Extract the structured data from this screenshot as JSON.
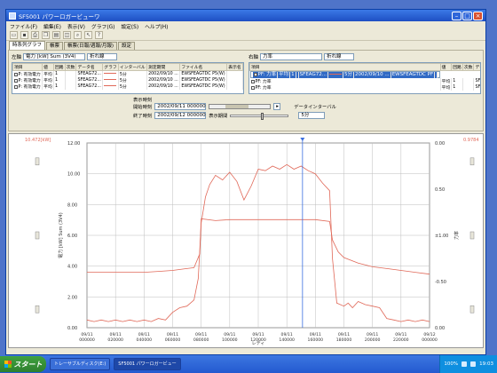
{
  "app": {
    "title": "SF5001 パワーロガービューワ"
  },
  "menu": [
    "ファイル(F)",
    "編集(E)",
    "表示(V)",
    "グラフ(G)",
    "設定(S)",
    "ヘルプ(H)"
  ],
  "tabs": [
    "時系列グラフ",
    "帳票",
    "帳票(日報/週報/月報)",
    "設定"
  ],
  "left_panel": {
    "axis_label": "左軸",
    "axis_value": "電力 [kW] Sum (3V4)",
    "chart_type": "折れ線",
    "columns": [
      "項目",
      "値",
      "回路",
      "次数",
      "データ名",
      "グラフ",
      "インターバル",
      "測定期間",
      "ファイル名",
      "表示名"
    ],
    "rows": [
      [
        "P: 有効電力",
        "平均",
        "1",
        "",
        "SFEAG72...",
        "",
        "5分",
        "2002/09/10 ...",
        "EWSFEAGTDC P5(W)",
        ""
      ],
      [
        "P: 有効電力",
        "平均",
        "1",
        "",
        "SFEAG72...",
        "",
        "5分",
        "2002/09/10 ...",
        "EWSFEAGTDC P5(W)",
        ""
      ],
      [
        "P: 有効電力",
        "平均",
        "1",
        "",
        "SFEAG72...",
        "",
        "5分",
        "2002/09/10 ...",
        "EWSFEAGTDC P5(W)",
        ""
      ]
    ]
  },
  "right_panel": {
    "axis_label": "右軸",
    "axis_value": "力率",
    "chart_type": "折れ線",
    "columns": [
      "項目",
      "値",
      "回路",
      "次数",
      "データ名",
      "グラフ",
      "インターバル",
      "測定期間",
      "ファイル名",
      "表示名"
    ],
    "rows": [
      [
        "PF: 力率",
        "平均",
        "1",
        "",
        "SFEAG72...",
        "",
        "5分",
        "2002/09/10 ...",
        "EWSFEAGTDC PF",
        ""
      ],
      [
        "PF: 力率",
        "平均",
        "1",
        "",
        "SFEAG72...",
        "",
        "5分",
        "2002/09/10 ...",
        "EWSFEAGTDC PF",
        ""
      ],
      [
        "PF: 力率",
        "平均",
        "1",
        "",
        "SFEAG72...",
        "",
        "5分",
        "2002/09/10 ...",
        "EWSFEAGTDC PF",
        ""
      ]
    ]
  },
  "controls": {
    "display_time_label": "表示時刻",
    "start_label": "開始時刻",
    "start_value": "2002/09/11 000000",
    "end_label": "終了時刻",
    "end_value": "2002/09/12 000000",
    "period_label": "表示期間",
    "interval_label": "データインターバル",
    "interval_value": "5分"
  },
  "chart_data": {
    "type": "line",
    "left_corner_label": "10.472[kW]",
    "right_corner_label": "0.9784",
    "ylabel_left": "電力 [kW] Sum (3V4)",
    "ylabel_right": "力率",
    "xlabel": "レディ",
    "ylim_left": [
      0,
      12
    ],
    "yticks_left": [
      "0.00",
      "2.00",
      "4.00",
      "6.00",
      "8.00",
      "10.00",
      "12.00"
    ],
    "ylim_right": [
      -1,
      1
    ],
    "yticks_right": [
      {
        "v": 1,
        "label": "0.00"
      },
      {
        "v": 0.5,
        "label": "0.50"
      },
      {
        "v": 0,
        "label": "±1.00"
      },
      {
        "v": -0.5,
        "label": "-0.50"
      },
      {
        "v": -1,
        "label": "0.00"
      }
    ],
    "categories": [
      [
        "09/11",
        "000000"
      ],
      [
        "09/11",
        "020000"
      ],
      [
        "09/11",
        "040000"
      ],
      [
        "09/11",
        "060000"
      ],
      [
        "09/11",
        "080000"
      ],
      [
        "09/11",
        "100000"
      ],
      [
        "09/11",
        "120000"
      ],
      [
        "09/11",
        "140000"
      ],
      [
        "09/11",
        "160000"
      ],
      [
        "09/11",
        "180000"
      ],
      [
        "09/11",
        "200000"
      ],
      [
        "09/11",
        "220000"
      ],
      [
        "09/12",
        "000000"
      ]
    ],
    "cursor_hour": 15.1,
    "series": [
      {
        "axis": "left",
        "x": [
          0,
          0.5,
          1,
          1.5,
          2,
          2.5,
          3,
          3.5,
          4,
          4.5,
          5,
          5.5,
          6,
          6.5,
          7,
          7.5,
          7.8,
          8,
          8.3,
          8.6,
          9,
          9.5,
          10,
          10.5,
          11,
          11.5,
          12,
          12.5,
          13,
          13.5,
          14,
          14.5,
          15,
          15.5,
          16,
          16.5,
          17,
          17.2,
          17.5,
          18,
          18.3,
          18.6,
          19,
          19.5,
          20,
          20.5,
          21,
          21.5,
          22,
          22.5,
          23,
          23.5,
          24
        ],
        "y": [
          0.5,
          0.4,
          0.5,
          0.4,
          0.5,
          0.4,
          0.5,
          0.4,
          0.5,
          0.4,
          0.6,
          0.5,
          1.0,
          1.3,
          1.4,
          1.8,
          3.2,
          6.8,
          8.5,
          9.3,
          9.9,
          9.6,
          10.1,
          9.5,
          8.3,
          9.2,
          10.3,
          10.2,
          10.5,
          10.3,
          10.6,
          10.3,
          10.5,
          10.2,
          10.0,
          9.4,
          8.9,
          4.5,
          1.6,
          1.4,
          1.6,
          1.3,
          1.7,
          1.5,
          1.4,
          1.3,
          0.6,
          0.5,
          0.4,
          0.5,
          0.4,
          0.5,
          0.4
        ]
      },
      {
        "axis": "right",
        "x": [
          0,
          1,
          2,
          3,
          4,
          5,
          6,
          7,
          7.5,
          7.9,
          8.0,
          9,
          10,
          11,
          12,
          13,
          14,
          15,
          16,
          17,
          17.2,
          17.6,
          18,
          19,
          20,
          21,
          22,
          23,
          24
        ],
        "y": [
          -0.4,
          -0.4,
          -0.4,
          -0.4,
          -0.4,
          -0.39,
          -0.38,
          -0.36,
          -0.35,
          -0.2,
          0.18,
          0.16,
          0.17,
          0.17,
          0.17,
          0.17,
          0.17,
          0.17,
          0.17,
          0.15,
          -0.05,
          -0.18,
          -0.24,
          -0.3,
          -0.34,
          -0.36,
          -0.38,
          -0.4,
          -0.42
        ]
      }
    ],
    "colors": {
      "line": "#e06858",
      "grid": "#bdbdbd",
      "cursor": "#3b6fe0",
      "corner_text": "#e06858"
    }
  },
  "taskbar": {
    "start": "スタート",
    "buttons": [
      "トレーサブルディスク(E:)",
      "SF5001 パワーロガービュー"
    ],
    "tray_time": "19:03",
    "tray_text": "100%"
  }
}
